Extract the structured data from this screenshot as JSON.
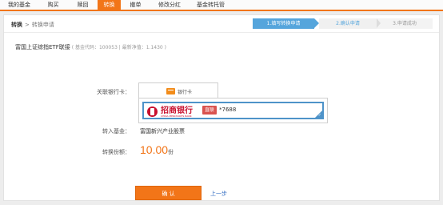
{
  "nav": {
    "items": [
      {
        "label": "我的基金",
        "width": 48
      },
      {
        "label": "购买",
        "width": 37
      },
      {
        "label": "赎回",
        "width": 37
      },
      {
        "label": "转换",
        "width": 29,
        "active": true
      },
      {
        "label": "撤单",
        "width": 37
      },
      {
        "label": "修改分红",
        "width": 48
      },
      {
        "label": "基金转托管",
        "width": 55
      }
    ]
  },
  "breadcrumb": {
    "main": "转换",
    "separator": ">",
    "current": "转换申请"
  },
  "steps": {
    "step1": "1.填写转换申请",
    "step2": "2.确认申请",
    "step3": "3.申请成功"
  },
  "fund": {
    "name": "富国上证综指ETF联接",
    "meta": "( 基金代码：100053 | 最新净值：1.1430 )"
  },
  "bank": {
    "label": "关联银行卡：",
    "tab_label": "银行卡",
    "bank_name": "招商银行",
    "bank_sub": "CHINA MERCHANTS BANK",
    "tag": "直联",
    "card_tail": "*7688"
  },
  "target_fund": {
    "label": "转入基金：",
    "value": "富国新兴产业股票"
  },
  "shares": {
    "label": "转换份额：",
    "value": "10.00",
    "unit": "份"
  },
  "actions": {
    "confirm": "确  认",
    "prev": "上一步"
  },
  "colors": {
    "accent": "#f27518",
    "step_blue": "#55a5dc",
    "bank_red": "#c8102e"
  }
}
